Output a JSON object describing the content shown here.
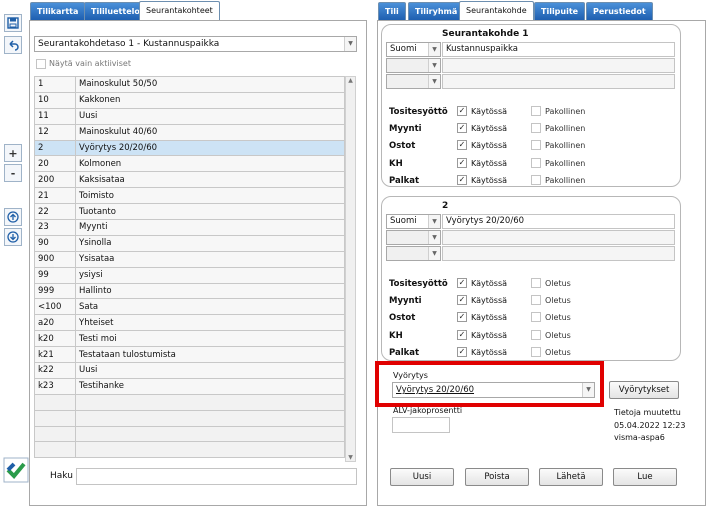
{
  "left_tabs": [
    "Tilikartta",
    "Tililuettelo",
    "Seurantakohteet"
  ],
  "right_tabs": [
    "Tili",
    "Tiliryhmä",
    "Seurantakohde",
    "Tilipuite",
    "Perustiedot"
  ],
  "level_select": "Seurantakohdetaso 1 - Kustannuspaikka",
  "active_only_label": "Näytä vain aktiiviset",
  "rows": [
    {
      "code": "1",
      "name": "Mainoskulut 50/50"
    },
    {
      "code": "10",
      "name": "Kakkonen"
    },
    {
      "code": "11",
      "name": "Uusi"
    },
    {
      "code": "12",
      "name": "Mainoskulut 40/60"
    },
    {
      "code": "2",
      "name": "Vyörytys 20/20/60"
    },
    {
      "code": "20",
      "name": "Kolmonen"
    },
    {
      "code": "200",
      "name": "Kaksisataa"
    },
    {
      "code": "21",
      "name": "Toimisto"
    },
    {
      "code": "22",
      "name": "Tuotanto"
    },
    {
      "code": "23",
      "name": "Myynti"
    },
    {
      "code": "90",
      "name": "Ysinolla"
    },
    {
      "code": "900",
      "name": "Ysisataa"
    },
    {
      "code": "99",
      "name": "ysiysi"
    },
    {
      "code": "999",
      "name": "Hallinto"
    },
    {
      "code": "<100",
      "name": "Sata"
    },
    {
      "code": "a20",
      "name": "Yhteiset"
    },
    {
      "code": "k20",
      "name": "Testi moi"
    },
    {
      "code": "k21",
      "name": "Testataan tulostumista"
    },
    {
      "code": "k22",
      "name": "Uusi"
    },
    {
      "code": "k23",
      "name": "Testihanke"
    }
  ],
  "selected_row": 4,
  "search_label": "Haku",
  "group1": {
    "title": "Seurantakohde 1",
    "lang": "Suomi",
    "name": "Kustannuspaikka",
    "col2": "Pakollinen",
    "rows": [
      {
        "label": "Tositesyöttö",
        "enabled": "Käytössä"
      },
      {
        "label": "Myynti",
        "enabled": "Käytössä"
      },
      {
        "label": "Ostot",
        "enabled": "Käytössä"
      },
      {
        "label": "KH",
        "enabled": "Käytössä"
      },
      {
        "label": "Palkat",
        "enabled": "Käytössä"
      }
    ]
  },
  "group2": {
    "title": "2",
    "lang": "Suomi",
    "name": "Vyörytys 20/20/60",
    "col2": "Oletus",
    "rows": [
      {
        "label": "Tositesyöttö",
        "enabled": "Käytössä"
      },
      {
        "label": "Myynti",
        "enabled": "Käytössä"
      },
      {
        "label": "Ostot",
        "enabled": "Käytössä"
      },
      {
        "label": "KH",
        "enabled": "Käytössä"
      },
      {
        "label": "Palkat",
        "enabled": "Käytössä"
      }
    ]
  },
  "allocation": {
    "label": "Vyörytys",
    "value": "Vyörytys 20/20/60",
    "button": "Vyörytykset"
  },
  "vat_label": "ALV-jakoprosentti",
  "info": {
    "line1": "Tietoja muutettu",
    "line2": "05.04.2022 12:23",
    "line3": "visma-aspa6"
  },
  "buttons": {
    "new": "Uusi",
    "delete": "Poista",
    "send": "Lähetä",
    "read": "Lue"
  },
  "colors": {
    "tab_blue": "#1e5fb0",
    "highlight_red": "#e00000",
    "selected_row": "#cde3f5"
  }
}
